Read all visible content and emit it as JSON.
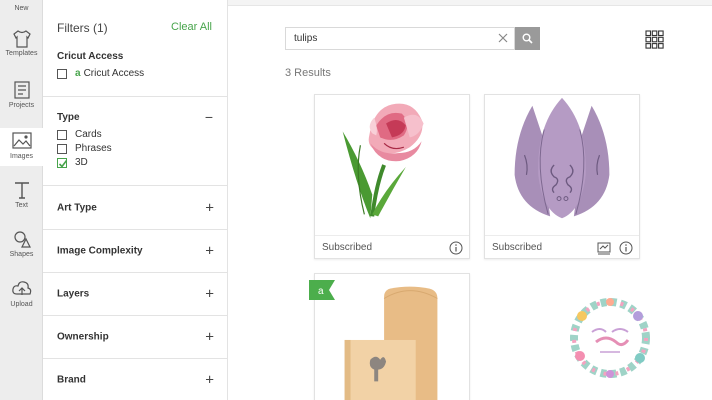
{
  "rail": {
    "items": [
      {
        "label": "New",
        "icon": "new-icon"
      },
      {
        "label": "Templates",
        "icon": "shirt-icon"
      },
      {
        "label": "Projects",
        "icon": "projects-icon"
      },
      {
        "label": "Images",
        "icon": "image-icon",
        "active": true
      },
      {
        "label": "Text",
        "icon": "text-icon"
      },
      {
        "label": "Shapes",
        "icon": "shapes-icon"
      },
      {
        "label": "Upload",
        "icon": "upload-icon"
      }
    ]
  },
  "filters": {
    "title": "Filters (1)",
    "clear_all": "Clear All",
    "cricut_access": {
      "heading": "Cricut Access",
      "option": "Cricut Access",
      "checked": false
    },
    "type": {
      "heading": "Type",
      "toggle": "−",
      "options": [
        {
          "label": "Cards",
          "checked": false
        },
        {
          "label": "Phrases",
          "checked": false
        },
        {
          "label": "3D",
          "checked": true
        }
      ]
    },
    "accordions": [
      {
        "label": "Art Type",
        "toggle": "+"
      },
      {
        "label": "Image Complexity",
        "toggle": "+"
      },
      {
        "label": "Layers",
        "toggle": "+"
      },
      {
        "label": "Ownership",
        "toggle": "+"
      },
      {
        "label": "Brand",
        "toggle": "+"
      }
    ]
  },
  "search": {
    "value": "tulips",
    "placeholder": ""
  },
  "results": {
    "count_label": "3 Results",
    "cards": [
      {
        "status": "Subscribed",
        "image": "pink-parrot-tulip",
        "has_cut_icon": false
      },
      {
        "status": "Subscribed",
        "image": "purple-3d-tulip",
        "has_cut_icon": true
      },
      {
        "status": "",
        "image": "tan-tulip-card-envelope",
        "badge": "a"
      }
    ]
  },
  "colors": {
    "accent_green": "#47a44b",
    "rail_bg": "#ededed",
    "search_button": "#9a9a9a",
    "tulip_purple": "#a88fb8"
  }
}
